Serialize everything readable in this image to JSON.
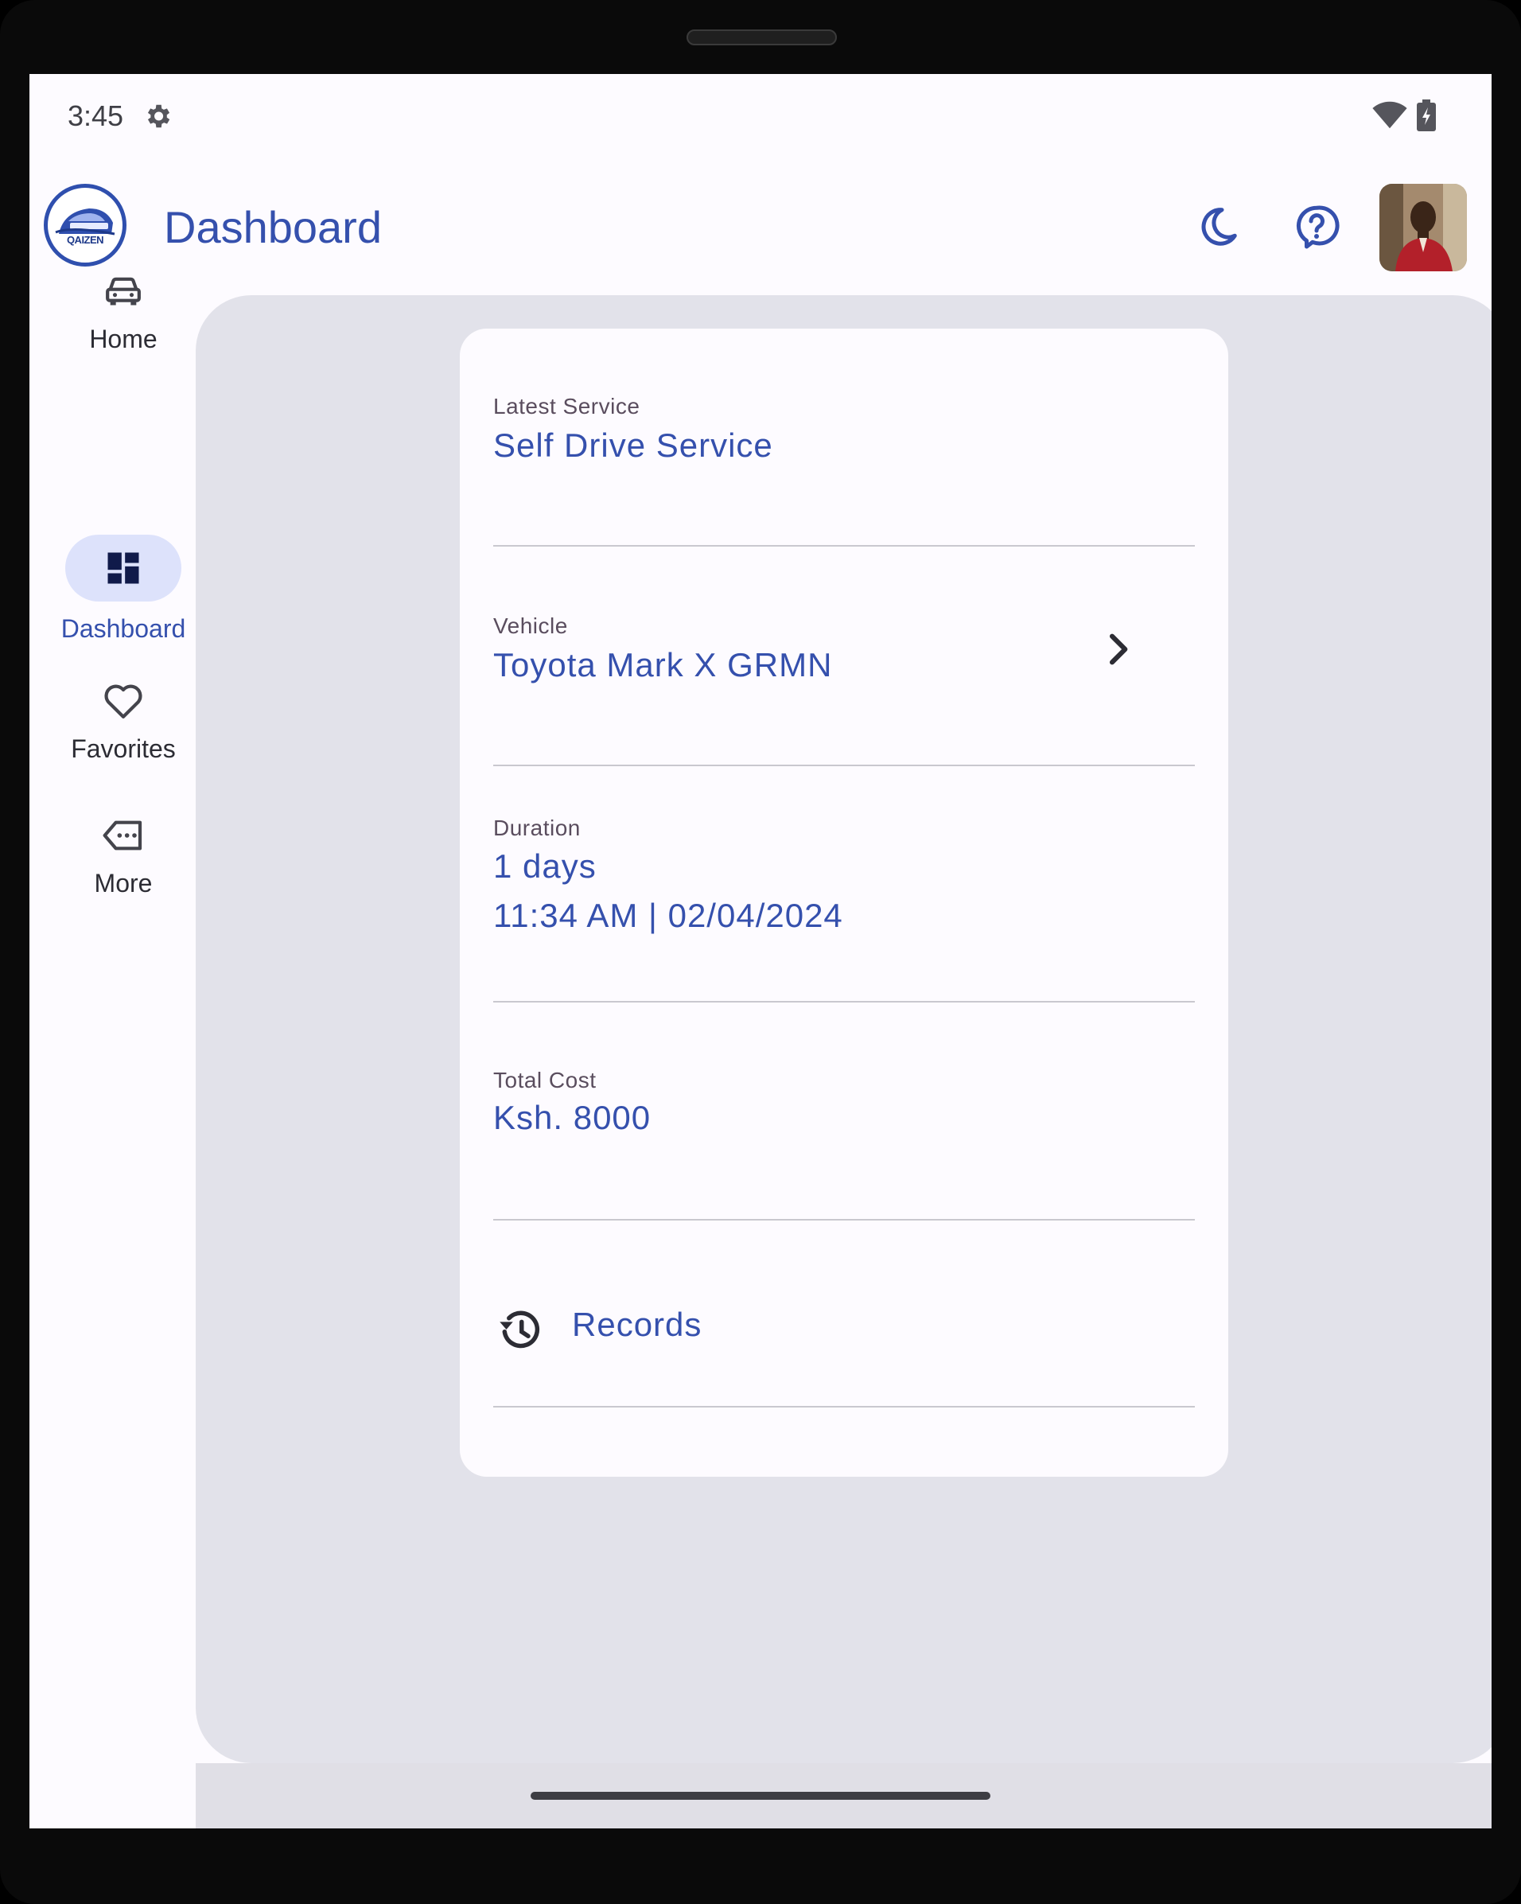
{
  "status_bar": {
    "time": "3:45",
    "icons": [
      "settings-icon",
      "wifi-icon",
      "battery-charging-icon"
    ]
  },
  "app_bar": {
    "logo_text": "QAIZEN",
    "title": "Dashboard",
    "actions": [
      "dark-mode-moon-icon",
      "help-icon",
      "profile-avatar"
    ]
  },
  "nav_rail": {
    "items": [
      {
        "label": "Home",
        "icon": "car-icon",
        "selected": false
      },
      {
        "label": "Dashboard",
        "icon": "dashboard-icon",
        "selected": true
      },
      {
        "label": "Favorites",
        "icon": "heart-icon",
        "selected": false
      },
      {
        "label": "More",
        "icon": "more-tag-icon",
        "selected": false
      }
    ]
  },
  "card": {
    "latest_service": {
      "label": "Latest Service",
      "value": "Self Drive Service"
    },
    "vehicle": {
      "label": "Vehicle",
      "value": "Toyota Mark X GRMN"
    },
    "duration": {
      "label": "Duration",
      "days": "1 days",
      "datetime": "11:34 AM | 02/04/2024"
    },
    "total_cost": {
      "label": "Total Cost",
      "value": "Ksh. 8000"
    },
    "records": {
      "label": "Records"
    }
  },
  "colors": {
    "primary": "#3550ad",
    "label": "#5a4d5e",
    "surface": "#fdfbff",
    "content_bg": "#e2e2ea",
    "active_pill": "#dde2fb"
  }
}
